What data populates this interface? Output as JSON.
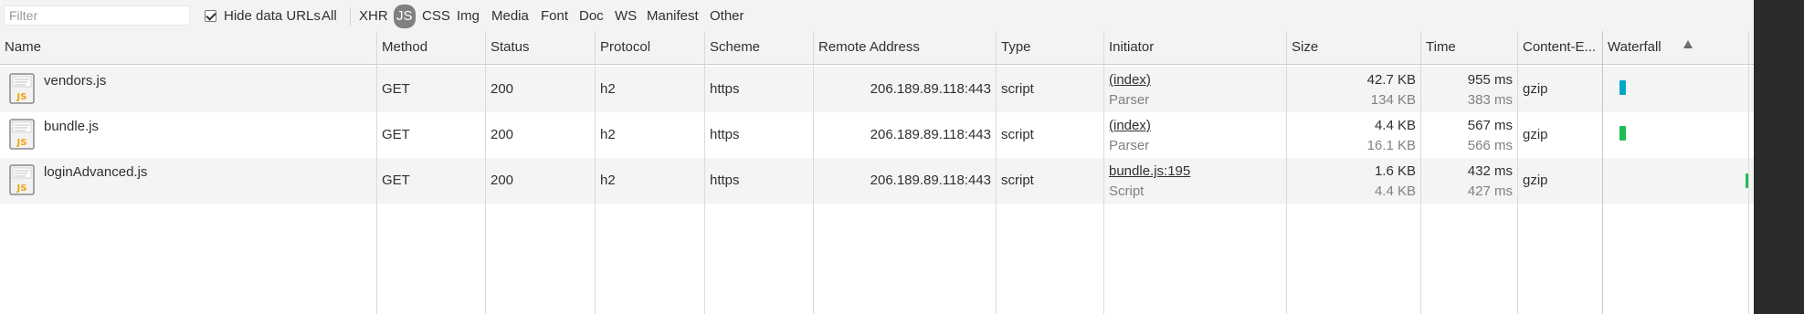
{
  "toolbar": {
    "filter_placeholder": "Filter",
    "hide_data_urls_label": "Hide data URLs",
    "type_filters": [
      "All",
      "XHR",
      "JS",
      "CSS",
      "Img",
      "Media",
      "Font",
      "Doc",
      "WS",
      "Manifest",
      "Other"
    ],
    "selected_type": "JS"
  },
  "columns": [
    "Name",
    "Method",
    "Status",
    "Protocol",
    "Scheme",
    "Remote Address",
    "Type",
    "Initiator",
    "Size",
    "Time",
    "Content-E...",
    "Waterfall"
  ],
  "rows": [
    {
      "name": "vendors.js",
      "icon": "js-file-icon",
      "method": "GET",
      "status": "200",
      "protocol": "h2",
      "scheme": "https",
      "remote_address": "206.189.89.118:443",
      "type": "script",
      "initiator": "(index)",
      "initiator_sub": "Parser",
      "size": "42.7 KB",
      "size_sub": "134 KB",
      "time": "955 ms",
      "time_sub": "383 ms",
      "content_encoding": "gzip",
      "waterfall_color": "#00a8c8"
    },
    {
      "name": "bundle.js",
      "icon": "js-file-icon",
      "method": "GET",
      "status": "200",
      "protocol": "h2",
      "scheme": "https",
      "remote_address": "206.189.89.118:443",
      "type": "script",
      "initiator": "(index)",
      "initiator_sub": "Parser",
      "size": "4.4 KB",
      "size_sub": "16.1 KB",
      "time": "567 ms",
      "time_sub": "566 ms",
      "content_encoding": "gzip",
      "waterfall_color": "#1dbb55"
    },
    {
      "name": "loginAdvanced.js",
      "icon": "js-file-icon",
      "method": "GET",
      "status": "200",
      "protocol": "h2",
      "scheme": "https",
      "remote_address": "206.189.89.118:443",
      "type": "script",
      "initiator": "bundle.js:195",
      "initiator_sub": "Script",
      "size": "1.6 KB",
      "size_sub": "4.4 KB",
      "time": "432 ms",
      "time_sub": "427 ms",
      "content_encoding": "gzip",
      "waterfall_color": "#1dbb55"
    }
  ],
  "colors": {
    "selected_filter_bg": "#808080",
    "odd_row_bg": "#f4f4f4",
    "header_bg": "#f3f3f3"
  }
}
